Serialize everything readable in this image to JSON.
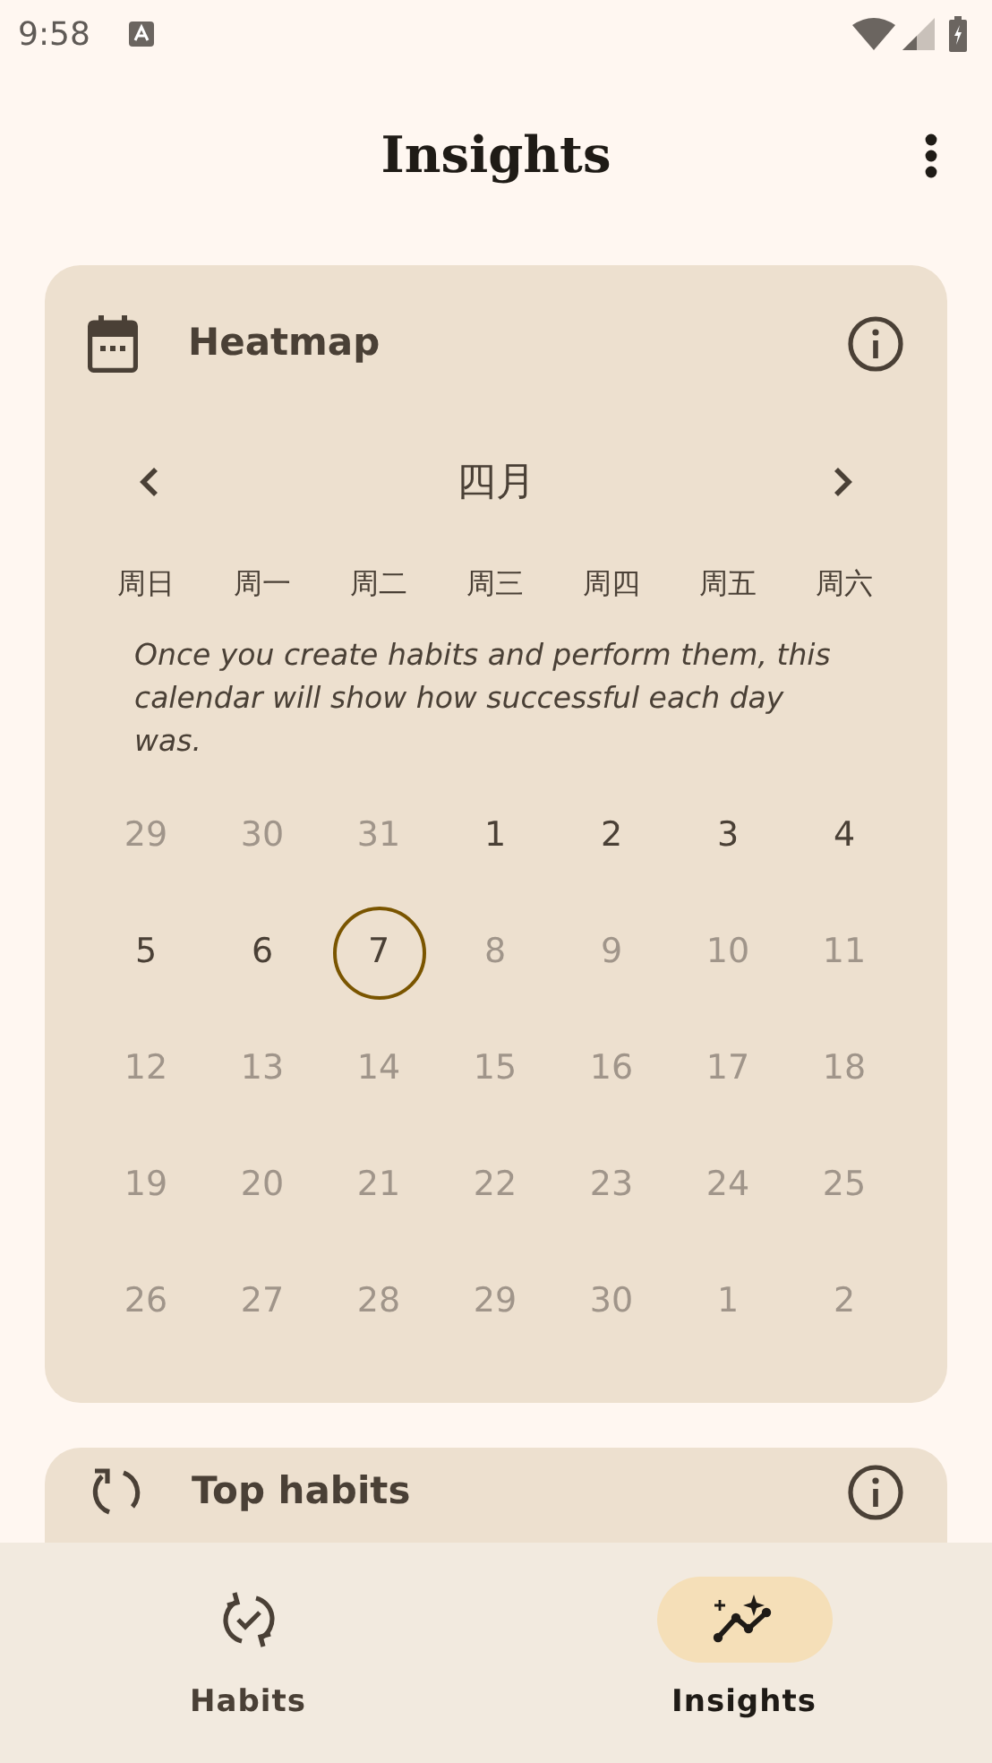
{
  "status_bar": {
    "time": "9:58"
  },
  "app_bar": {
    "title": "Insights"
  },
  "heatmap_card": {
    "title": "Heatmap",
    "month": "四月",
    "weekdays": [
      "周日",
      "周一",
      "周二",
      "周三",
      "周四",
      "周五",
      "周六"
    ],
    "empty_message": "Once you create habits and perform them, this calendar will show how successful each day was.",
    "days": [
      {
        "label": "29",
        "muted": true,
        "selected": false
      },
      {
        "label": "30",
        "muted": true,
        "selected": false
      },
      {
        "label": "31",
        "muted": true,
        "selected": false
      },
      {
        "label": "1",
        "muted": false,
        "selected": false
      },
      {
        "label": "2",
        "muted": false,
        "selected": false
      },
      {
        "label": "3",
        "muted": false,
        "selected": false
      },
      {
        "label": "4",
        "muted": false,
        "selected": false
      },
      {
        "label": "5",
        "muted": false,
        "selected": false
      },
      {
        "label": "6",
        "muted": false,
        "selected": false
      },
      {
        "label": "7",
        "muted": false,
        "selected": true
      },
      {
        "label": "8",
        "muted": true,
        "selected": false
      },
      {
        "label": "9",
        "muted": true,
        "selected": false
      },
      {
        "label": "10",
        "muted": true,
        "selected": false
      },
      {
        "label": "11",
        "muted": true,
        "selected": false
      },
      {
        "label": "12",
        "muted": true,
        "selected": false
      },
      {
        "label": "13",
        "muted": true,
        "selected": false
      },
      {
        "label": "14",
        "muted": true,
        "selected": false
      },
      {
        "label": "15",
        "muted": true,
        "selected": false
      },
      {
        "label": "16",
        "muted": true,
        "selected": false
      },
      {
        "label": "17",
        "muted": true,
        "selected": false
      },
      {
        "label": "18",
        "muted": true,
        "selected": false
      },
      {
        "label": "19",
        "muted": true,
        "selected": false
      },
      {
        "label": "20",
        "muted": true,
        "selected": false
      },
      {
        "label": "21",
        "muted": true,
        "selected": false
      },
      {
        "label": "22",
        "muted": true,
        "selected": false
      },
      {
        "label": "23",
        "muted": true,
        "selected": false
      },
      {
        "label": "24",
        "muted": true,
        "selected": false
      },
      {
        "label": "25",
        "muted": true,
        "selected": false
      },
      {
        "label": "26",
        "muted": true,
        "selected": false
      },
      {
        "label": "27",
        "muted": true,
        "selected": false
      },
      {
        "label": "28",
        "muted": true,
        "selected": false
      },
      {
        "label": "29",
        "muted": true,
        "selected": false
      },
      {
        "label": "30",
        "muted": true,
        "selected": false
      },
      {
        "label": "1",
        "muted": true,
        "selected": false
      },
      {
        "label": "2",
        "muted": true,
        "selected": false
      }
    ]
  },
  "top_habits_card": {
    "title": "Top habits"
  },
  "bottom_nav": [
    {
      "label": "Habits",
      "kind": "habits",
      "selected": false
    },
    {
      "label": "Insights",
      "kind": "insights",
      "selected": true
    }
  ]
}
